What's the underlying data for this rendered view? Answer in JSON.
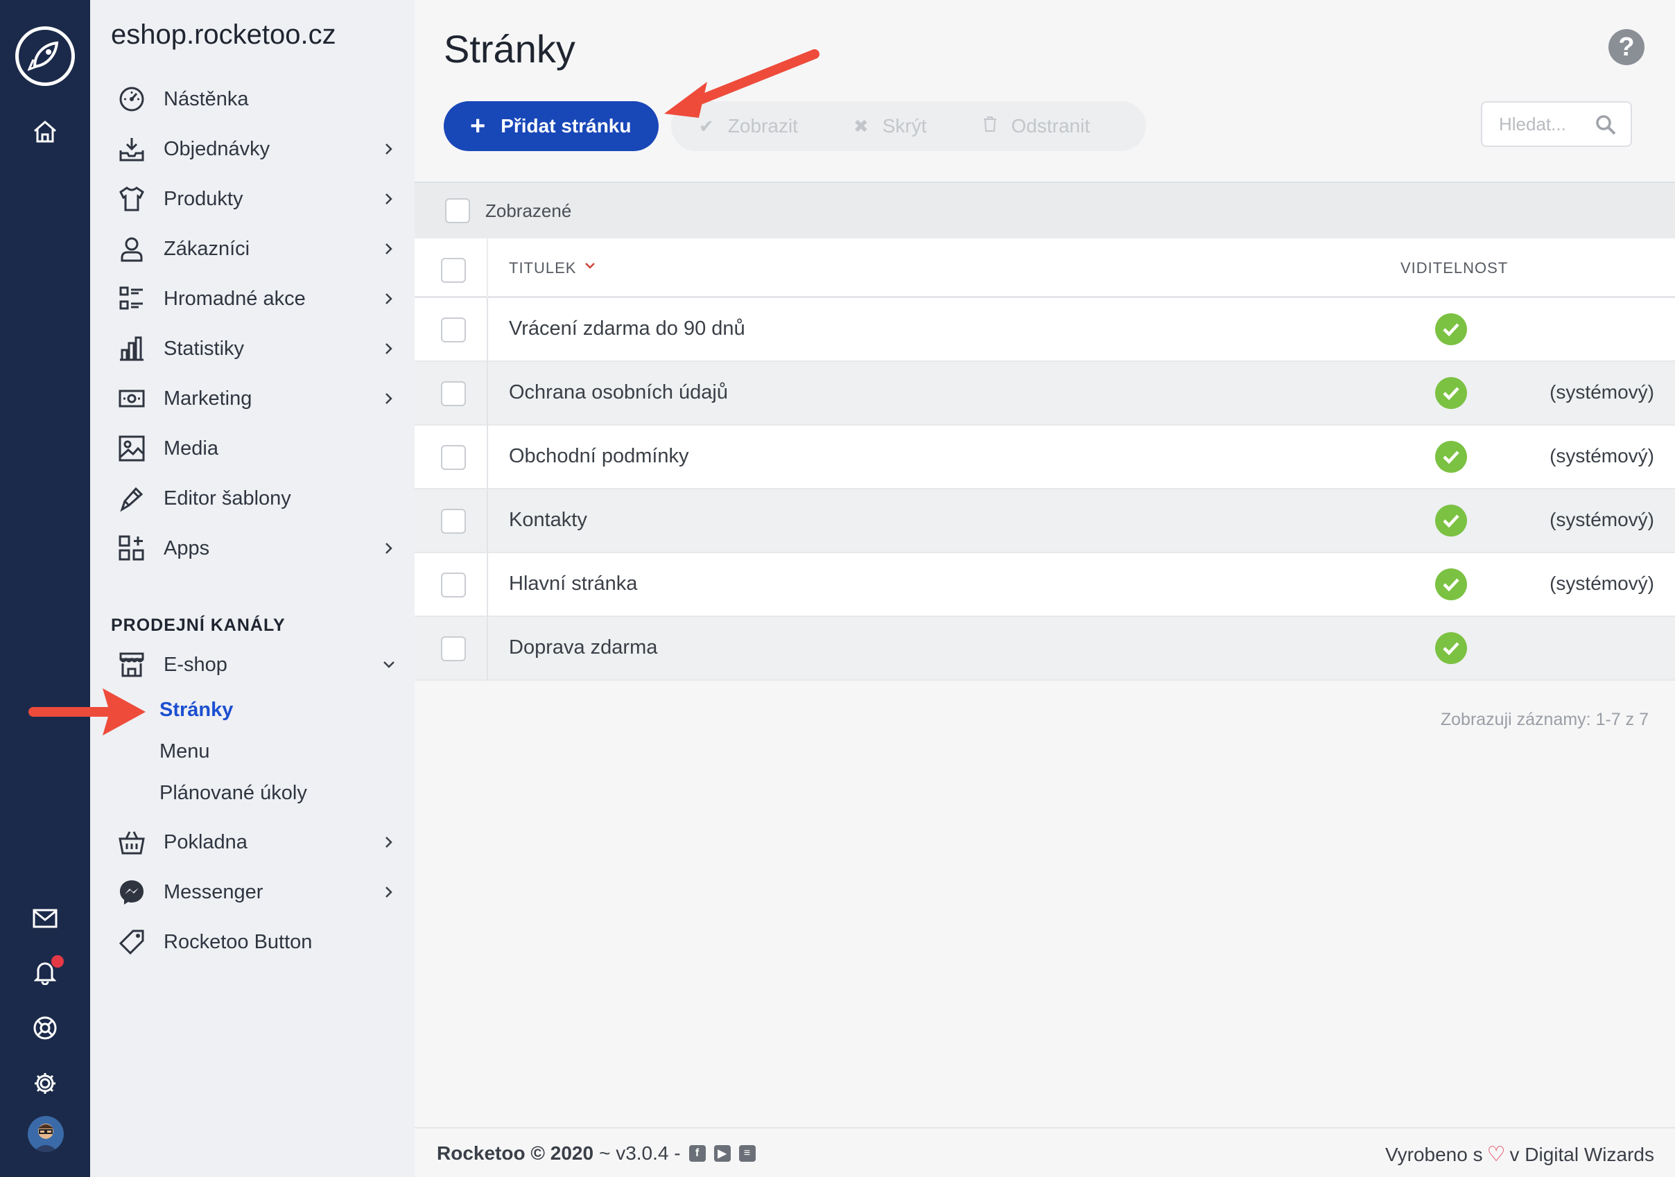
{
  "app": {
    "shop_domain": "eshop.rocketoo.cz",
    "accent": "#1847b8",
    "rail_color": "#1b2a4a"
  },
  "rail": {
    "icons": [
      "rocket-logo-icon",
      "home-icon",
      "mail-icon",
      "bell-icon",
      "lifebuoy-icon",
      "gear-icon",
      "avatar"
    ]
  },
  "sidebar": {
    "items": [
      {
        "label": "Nástěnka",
        "icon": "dashboard-icon",
        "has_chevron": false
      },
      {
        "label": "Objednávky",
        "icon": "inbox-download-icon",
        "has_chevron": true
      },
      {
        "label": "Produkty",
        "icon": "tshirt-icon",
        "has_chevron": true
      },
      {
        "label": "Zákazníci",
        "icon": "user-icon",
        "has_chevron": true
      },
      {
        "label": "Hromadné akce",
        "icon": "checklist-icon",
        "has_chevron": true
      },
      {
        "label": "Statistiky",
        "icon": "bar-chart-icon",
        "has_chevron": true
      },
      {
        "label": "Marketing",
        "icon": "money-icon",
        "has_chevron": true
      },
      {
        "label": "Media",
        "icon": "image-icon",
        "has_chevron": false
      },
      {
        "label": "Editor šablony",
        "icon": "brush-icon",
        "has_chevron": false
      },
      {
        "label": "Apps",
        "icon": "apps-grid-icon",
        "has_chevron": true
      }
    ],
    "section_title": "PRODEJNÍ KANÁLY",
    "eshop": {
      "label": "E-shop",
      "icon": "store-icon"
    },
    "eshop_sub": [
      {
        "label": "Stránky",
        "active": true
      },
      {
        "label": "Menu",
        "active": false
      },
      {
        "label": "Plánované úkoly",
        "active": false
      }
    ],
    "channels": [
      {
        "label": "Pokladna",
        "icon": "basket-icon",
        "has_chevron": true
      },
      {
        "label": "Messenger",
        "icon": "messenger-icon",
        "has_chevron": true
      },
      {
        "label": "Rocketoo Button",
        "icon": "tag-icon",
        "has_chevron": false
      }
    ]
  },
  "main": {
    "title": "Stránky",
    "add_button": "Přidat stránku",
    "actions": [
      {
        "label": "Zobrazit",
        "icon": "check-icon"
      },
      {
        "label": "Skrýt",
        "icon": "cross-icon"
      },
      {
        "label": "Odstranit",
        "icon": "trash-icon"
      }
    ],
    "search_placeholder": "Hledat...",
    "filter_label": "Zobrazené",
    "columns": {
      "title": "TITULEK",
      "visibility": "VIDITELNOST"
    },
    "rows": [
      {
        "title": "Vrácení zdarma do 90 dnů",
        "visible": true,
        "note": ""
      },
      {
        "title": "Ochrana osobních údajů",
        "visible": true,
        "note": "(systémový)"
      },
      {
        "title": "Obchodní podmínky",
        "visible": true,
        "note": "(systémový)"
      },
      {
        "title": "Kontakty",
        "visible": true,
        "note": "(systémový)"
      },
      {
        "title": "Hlavní stránka",
        "visible": true,
        "note": "(systémový)"
      },
      {
        "title": "Doprava zdarma",
        "visible": true,
        "note": ""
      }
    ],
    "records_text": "Zobrazuji záznamy: 1-7 z 7"
  },
  "footer": {
    "brand": "Rocketoo © 2020",
    "version": "~ v3.0.4 -",
    "made_prefix": "Vyrobeno s",
    "made_suffix": "v Digital Wizards"
  }
}
